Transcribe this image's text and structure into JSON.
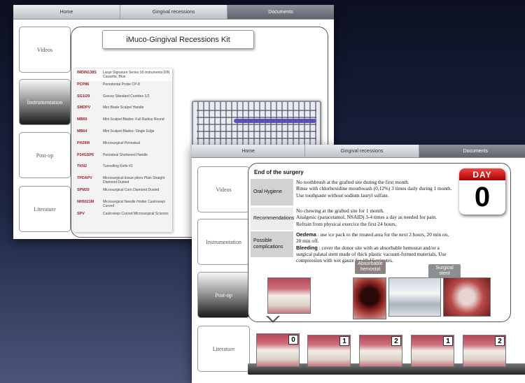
{
  "back": {
    "tabs": [
      "Home",
      "Gingival recessions",
      "Documents"
    ],
    "sidebar": [
      "Videos",
      "Instrumentation",
      "Post-op",
      "Literature"
    ],
    "title": "iMuco-Gingival Recessions Kit",
    "instruments": [
      {
        "code": "IMDIN138S",
        "desc": "Large Signature Series 18 instruments DIN Cassette, Blue"
      },
      {
        "code": "PCP86",
        "desc": "Periodontal Probe CP-8"
      },
      {
        "code": "SG1/29",
        "desc": "Gracey Standard Curettes 1/2"
      },
      {
        "code": "SMDPV",
        "desc": "Mini Blade Scalpel Handle"
      },
      {
        "code": "MB69",
        "desc": "Mini Scalpel Blades: Full Radius Round"
      },
      {
        "code": "MB64",
        "desc": "Mini Scalpel Blades: Single Edge"
      },
      {
        "code": "PH26M",
        "desc": "Microsurgical Periosteal"
      },
      {
        "code": "P24GSP6",
        "desc": "Periosteal Shortened Handle"
      },
      {
        "code": "TKN2",
        "desc": "Tunnelling Knife #2"
      },
      {
        "code": "TPDAPV",
        "desc": "Microsurgical tissue pliers Plain Straight Diamond Dusted"
      },
      {
        "code": "SPM20",
        "desc": "Microsurgical Corn Diamond Dusted"
      },
      {
        "code": "NH5021M",
        "desc": "Microsurgical Needle Holder Castroviejo Curved"
      },
      {
        "code": "SPV",
        "desc": "Castroviejo Curved Microsurgical Scissors"
      }
    ]
  },
  "front": {
    "tabs": [
      "Home",
      "Gingival recessions",
      "Documents"
    ],
    "sidebar": [
      "Videos",
      "Instrumentation",
      "Post-op",
      "Literature"
    ],
    "section_title": "End of the surgery",
    "rows": [
      {
        "label": "Oral Hygiene",
        "lines": [
          "No toothbrush at the grafted site during the first month.",
          "Rinse with chlorhexidine mouthwash (0,12%) 3 times daily during 1 month.",
          "Use toothpaste without sodium lauryl sulfate."
        ]
      },
      {
        "label": "Recommendations",
        "lines": [
          "No chewing at the grafted site for 1 month.",
          "Analgesic (paracetamol, NSAID) 3-4 times a day as needed for pain.",
          "Refrain from physical exercice the first 24 hours."
        ]
      },
      {
        "label": "Possible complications",
        "oedema_term": "Oedema",
        "oedema_text": " : use ice pack to the treated area for the next 2 hours, 20 min on, 20 min off.",
        "bleeding_term": "Bleeding",
        "bleeding_text": " : cover the donor site with an absorbable hemostat and/or a surgical palatal stent made of thick plastic vacuum-formed materials. Use compression with wet gauze for 10-15 minutes."
      }
    ],
    "calendar": {
      "label": "DAY",
      "value": "0"
    },
    "captions": {
      "hemostat": "Absorbable hemostat",
      "stent": "Surgical stent"
    },
    "thumb_badges": [
      "0",
      "1",
      "2",
      "1",
      "2"
    ]
  }
}
